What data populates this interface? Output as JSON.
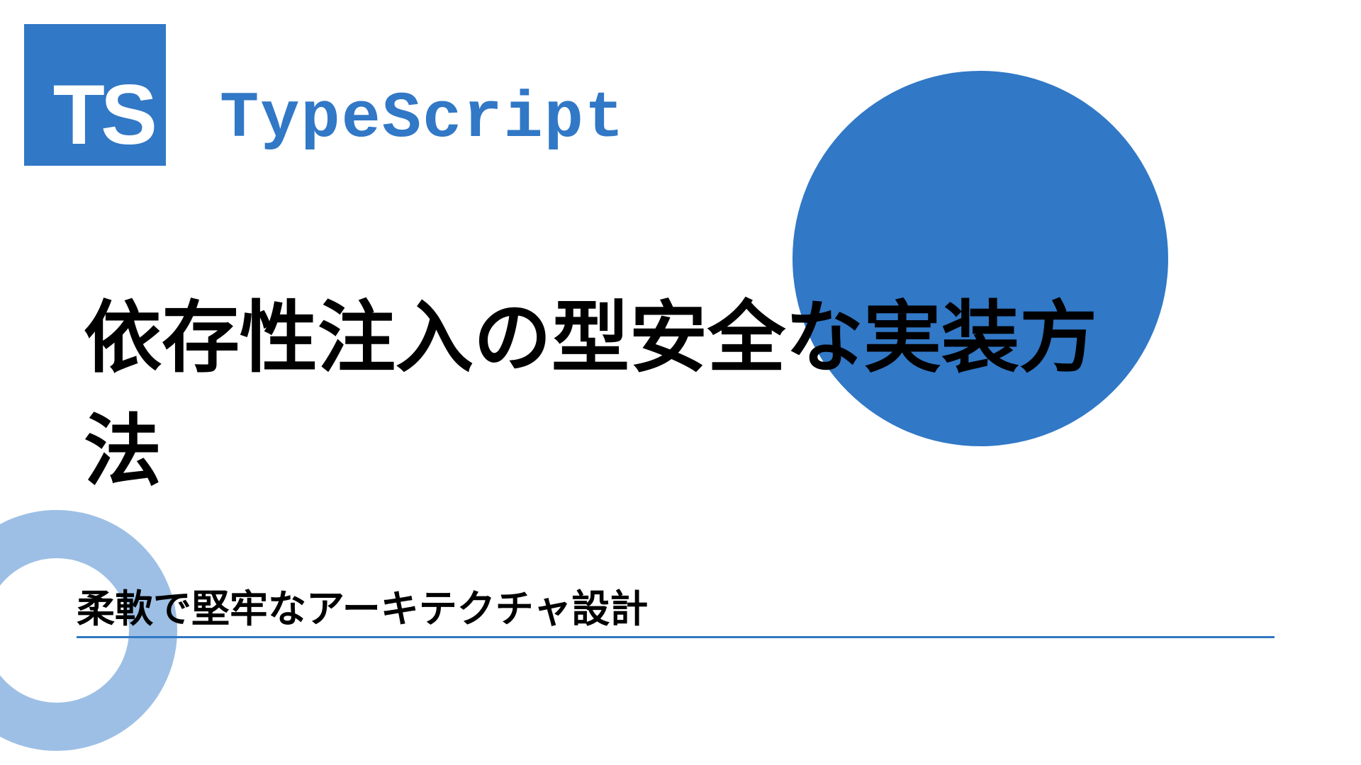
{
  "logo": {
    "text": "TS"
  },
  "brand": "TypeScript",
  "title": "依存性注入の型安全な実装方法",
  "subtitle": "柔軟で堅牢なアーキテクチャ設計"
}
